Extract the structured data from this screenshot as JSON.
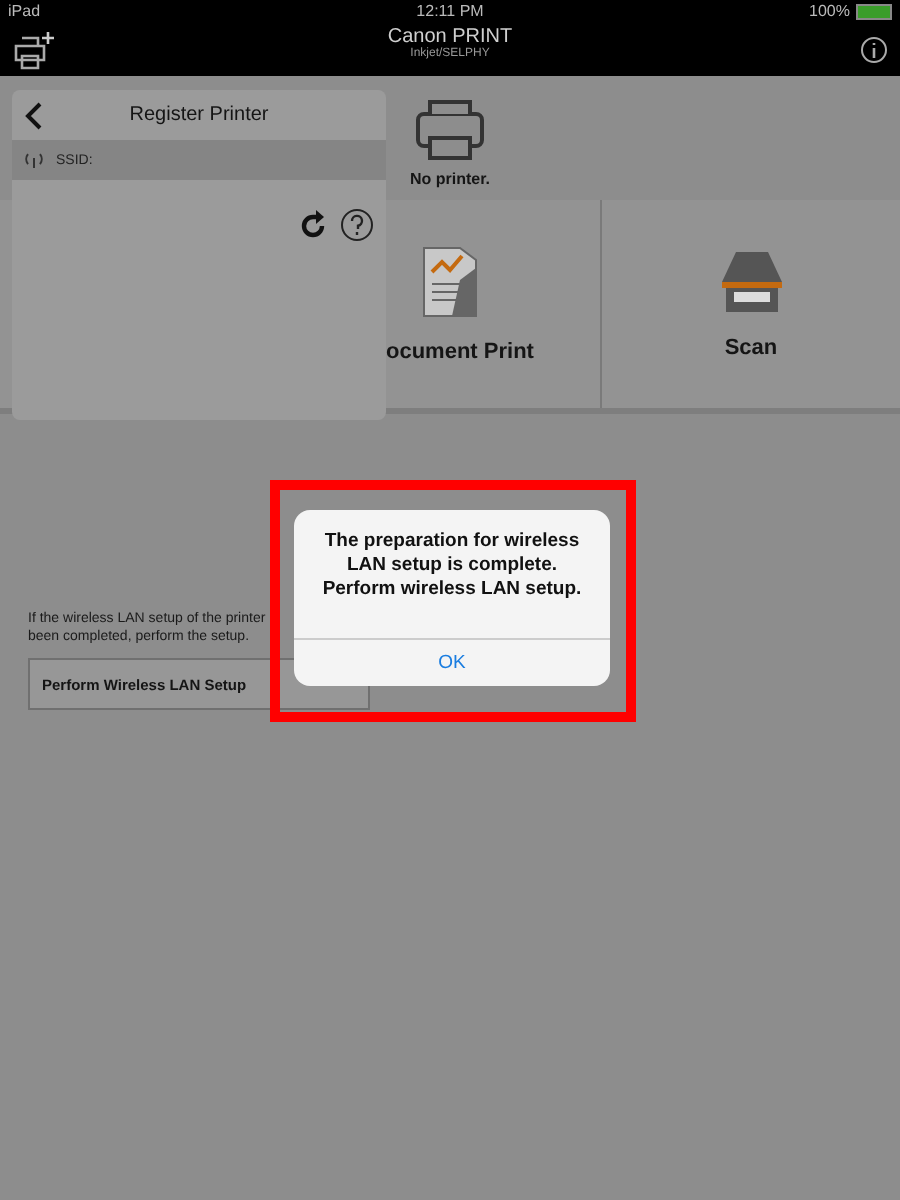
{
  "status_bar": {
    "device": "iPad",
    "time": "12:11 PM",
    "battery": "100%"
  },
  "nav_bar": {
    "title": "Canon PRINT",
    "subtitle": "Inkjet/SELPHY"
  },
  "printer": {
    "label": "No printer."
  },
  "tiles": [
    {
      "kind": "document",
      "label": "ocument Print"
    },
    {
      "kind": "scan",
      "label": "Scan"
    }
  ],
  "setup_hint": [
    "If the wireless LAN setup of the printer",
    "been completed, perform the setup."
  ],
  "setup_button": "Perform Wireless LAN Setup",
  "register_panel": {
    "title": "Register Printer",
    "ssid_label": "SSID:"
  },
  "alert": {
    "message": "The preparation for wireless LAN setup is complete. Perform wireless LAN setup.",
    "button": "OK"
  }
}
